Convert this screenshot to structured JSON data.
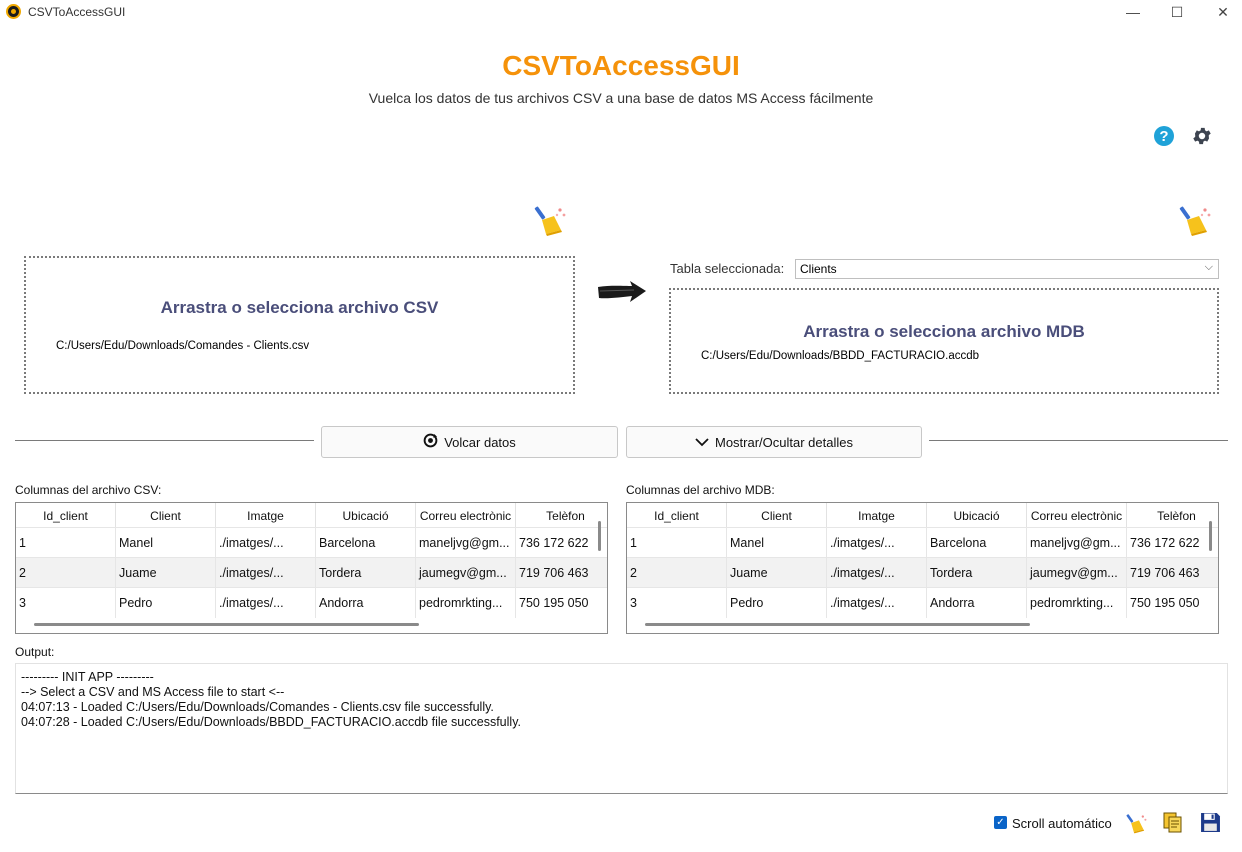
{
  "window": {
    "title": "CSVToAccessGUI",
    "minimize": "—",
    "maximize": "☐",
    "close": "✕"
  },
  "header": {
    "title": "CSVToAccessGUI",
    "subtitle": "Vuelca los datos de tus archivos CSV a una base de datos MS Access fácilmente",
    "help": "?"
  },
  "csv_zone": {
    "title": "Arrastra o selecciona archivo CSV",
    "path": "C:/Users/Edu/Downloads/Comandes - Clients.csv"
  },
  "mdb_zone": {
    "title": "Arrastra o selecciona archivo MDB",
    "path": "C:/Users/Edu/Downloads/BBDD_FACTURACIO.accdb"
  },
  "table_select": {
    "label": "Tabla seleccionada:",
    "value": "Clients"
  },
  "actions": {
    "dump_label": "Volcar datos",
    "toggle_label": "Mostrar/Ocultar detalles"
  },
  "csv_columns": {
    "label": "Columnas del archivo CSV:",
    "headers": [
      "Id_client",
      "Client",
      "Imatge",
      "Ubicació",
      "Correu electrònic",
      "Telèfon"
    ],
    "rows": [
      [
        "1",
        "Manel",
        "./imatges/...",
        "Barcelona",
        "maneljvg@gm...",
        "736 172 622"
      ],
      [
        "2",
        "Juame",
        "./imatges/...",
        "Tordera",
        "jaumegv@gm...",
        "719 706 463"
      ],
      [
        "3",
        "Pedro",
        "./imatges/...",
        "Andorra",
        "pedromrkting...",
        "750 195 050"
      ]
    ]
  },
  "mdb_columns": {
    "label": "Columnas del archivo MDB:",
    "headers": [
      "Id_client",
      "Client",
      "Imatge",
      "Ubicació",
      "Correu electrònic",
      "Telèfon"
    ],
    "rows": [
      [
        "1",
        "Manel",
        "./imatges/...",
        "Barcelona",
        "maneljvg@gm...",
        "736 172 622"
      ],
      [
        "2",
        "Juame",
        "./imatges/...",
        "Tordera",
        "jaumegv@gm...",
        "719 706 463"
      ],
      [
        "3",
        "Pedro",
        "./imatges/...",
        "Andorra",
        "pedromrkting...",
        "750 195 050"
      ]
    ]
  },
  "output": {
    "label": "Output:",
    "lines": [
      "--------- INIT APP ---------",
      "--> Select a CSV and MS Access file to start <--",
      "04:07:13 - Loaded C:/Users/Edu/Downloads/Comandes - Clients.csv file successfully.",
      "04:07:28 - Loaded C:/Users/Edu/Downloads/BBDD_FACTURACIO.accdb file successfully."
    ]
  },
  "footer": {
    "autoscroll_label": "Scroll automático",
    "autoscroll_checked": true
  },
  "colors": {
    "accent": "#f5920a",
    "zone_title": "#4a4e7a",
    "help": "#1fa2d8",
    "checkbox": "#0a64c8"
  }
}
